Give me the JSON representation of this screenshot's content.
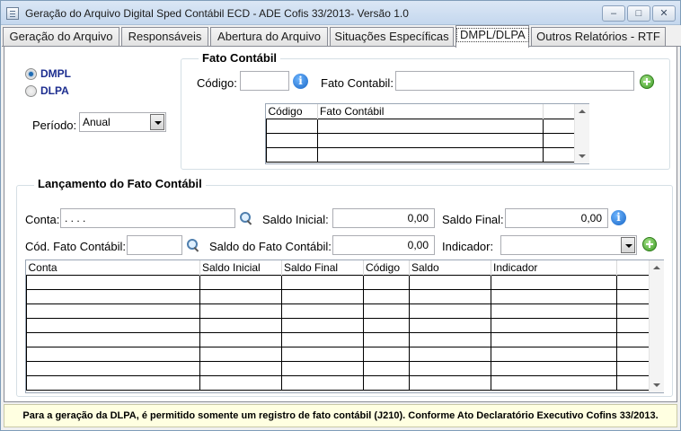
{
  "window": {
    "title": "Geração do Arquivo Digital Sped Contábil ECD - ADE Cofis 33/2013- Versão 1.0",
    "minimize_glyph": "–",
    "maximize_glyph": "□",
    "close_glyph": "✕"
  },
  "tabs": [
    {
      "label": "Geração do Arquivo"
    },
    {
      "label": "Responsáveis"
    },
    {
      "label": "Abertura do Arquivo"
    },
    {
      "label": "Situações Específicas"
    },
    {
      "label": "DMPL/DLPA",
      "active": true
    },
    {
      "label": "Outros Relatórios - RTF"
    }
  ],
  "report_type": {
    "options": [
      "DMPL",
      "DLPA"
    ],
    "selected": "DMPL"
  },
  "periodo": {
    "label": "Período:",
    "value": "Anual"
  },
  "fato_contabil": {
    "title": "Fato Contábil",
    "codigo_label": "Código:",
    "codigo_value": "",
    "descricao_label": "Fato Contabil:",
    "descricao_value": "",
    "columns": [
      "Código",
      "Fato Contábil"
    ],
    "rows": [
      [
        "",
        ""
      ],
      [
        "",
        ""
      ],
      [
        "",
        ""
      ]
    ]
  },
  "lancamento": {
    "title": "Lançamento do Fato Contábil",
    "conta_label": "Conta:",
    "conta_value": ". . . .",
    "saldo_inicial_label": "Saldo Inicial:",
    "saldo_inicial_value": "0,00",
    "saldo_final_label": "Saldo Final:",
    "saldo_final_value": "0,00",
    "cod_fato_label": "Cód. Fato Contábil:",
    "cod_fato_value": "",
    "saldo_fato_label": "Saldo do Fato Contábil:",
    "saldo_fato_value": "0,00",
    "indicador_label": "Indicador:",
    "indicador_value": "",
    "columns": [
      "Conta",
      "Saldo Inicial",
      "Saldo Final",
      "Código",
      "Saldo",
      "Indicador"
    ],
    "row_count": 8
  },
  "footer": {
    "message": "Para a geração da DLPA, é permitido somente um registro de fato contábil (J210). Conforme Ato Declaratório Executivo Cofins 33/2013."
  },
  "icons": {
    "info": "info-icon",
    "add": "add-icon",
    "search": "search-icon",
    "accent_blue": "#1664c4",
    "accent_green": "#3b9a23"
  }
}
